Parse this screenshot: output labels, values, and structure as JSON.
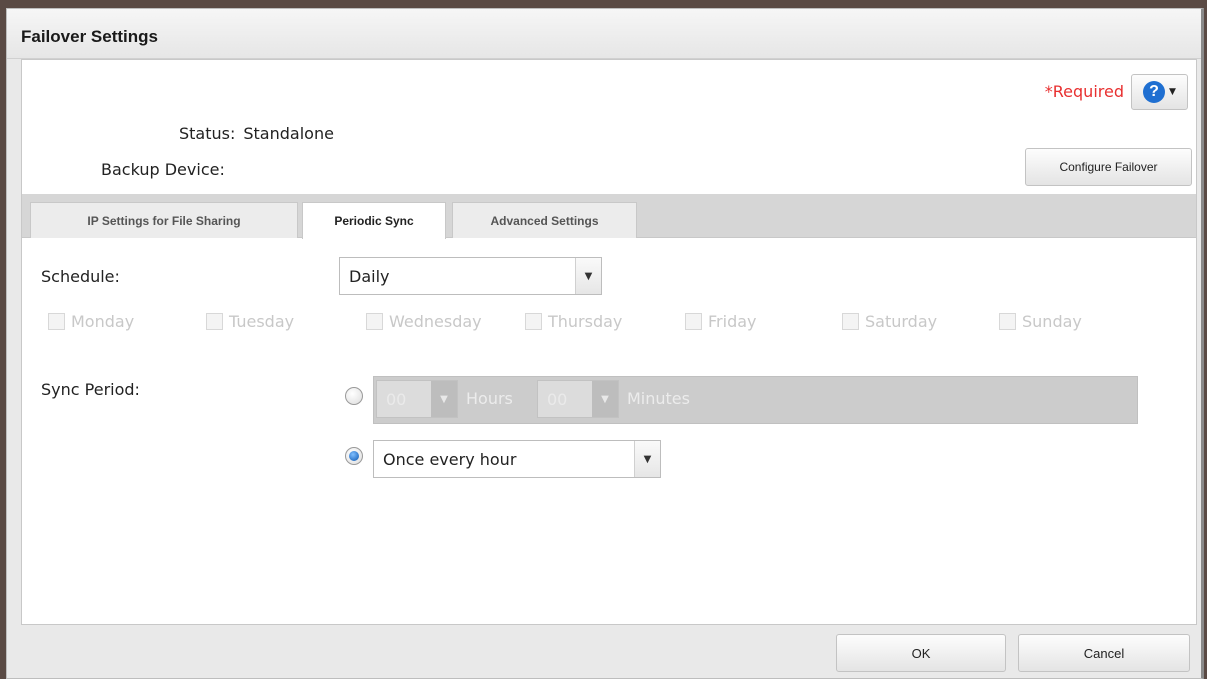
{
  "dialog": {
    "title": "Failover Settings",
    "required_text": "*Required",
    "help_icon": "question-circle-icon",
    "status": {
      "label": "Status:",
      "value": "Standalone"
    },
    "backup_device": {
      "label": "Backup Device:",
      "value": ""
    },
    "configure_button": "Configure Failover"
  },
  "tabs": [
    {
      "label": "IP Settings for File Sharing",
      "active": false
    },
    {
      "label": "Periodic Sync",
      "active": true
    },
    {
      "label": "Advanced Settings",
      "active": false
    }
  ],
  "schedule": {
    "label": "Schedule:",
    "selected": "Daily",
    "days": [
      "Monday",
      "Tuesday",
      "Wednesday",
      "Thursday",
      "Friday",
      "Saturday",
      "Sunday"
    ]
  },
  "sync_period": {
    "label": "Sync Period:",
    "custom_option": {
      "selected": false,
      "hours_value": "00",
      "hours_label": "Hours",
      "minutes_value": "00",
      "minutes_label": "Minutes"
    },
    "interval_option": {
      "selected": true,
      "value": "Once every hour"
    }
  },
  "footer": {
    "ok_label": "OK",
    "cancel_label": "Cancel"
  },
  "colors": {
    "required": "#e83030",
    "help_accent": "#1f6fd1"
  }
}
